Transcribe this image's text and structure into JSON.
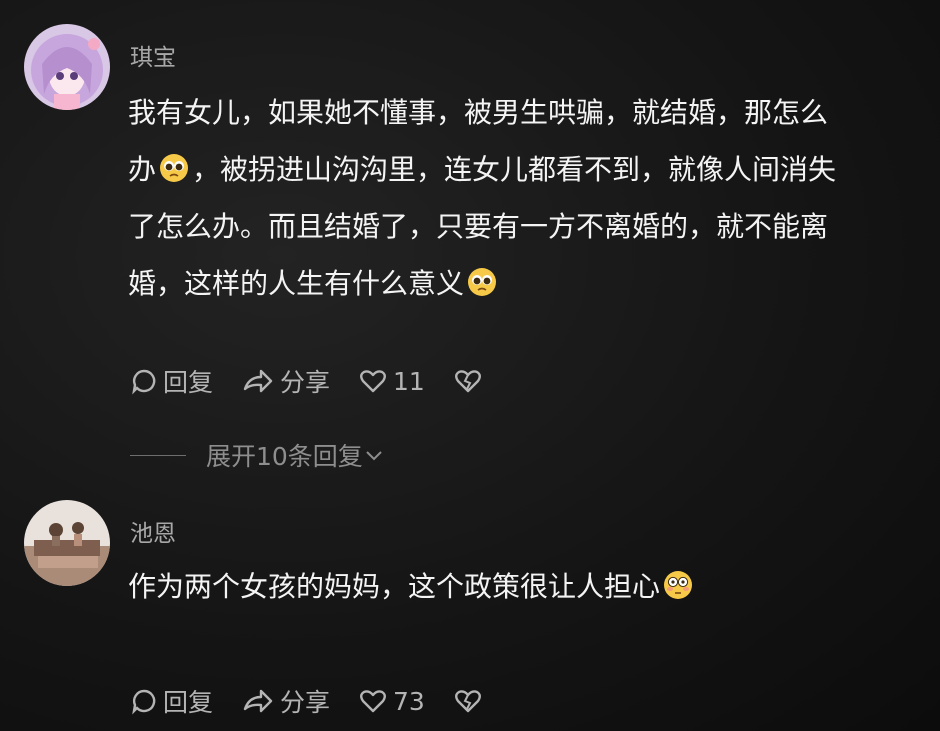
{
  "comments": [
    {
      "username": "琪宝",
      "text_lines": [
        "我有女儿，如果她不懂事，被男生哄骗，就结婚，那怎么",
        "，被拐进山沟沟里，连女儿都看不到，就像人间消失",
        "了怎么办。而且结婚了，只要有一方不离婚的，就不能离",
        "婚，这样的人生有什么意义"
      ],
      "line2_prefix": "办",
      "reply_label": "回复",
      "share_label": "分享",
      "like_count": "11",
      "emoji": "pleading-face-icon"
    },
    {
      "username": "池恩",
      "text": "作为两个女孩的妈妈，这个政策很让人担心",
      "reply_label": "回复",
      "share_label": "分享",
      "like_count": "73",
      "emoji": "flushed-face-icon"
    }
  ],
  "expand_replies": "展开10条回复",
  "colors": {
    "background": "#151515",
    "text": "#f4f4f4",
    "secondary": "#a8a8a8"
  }
}
